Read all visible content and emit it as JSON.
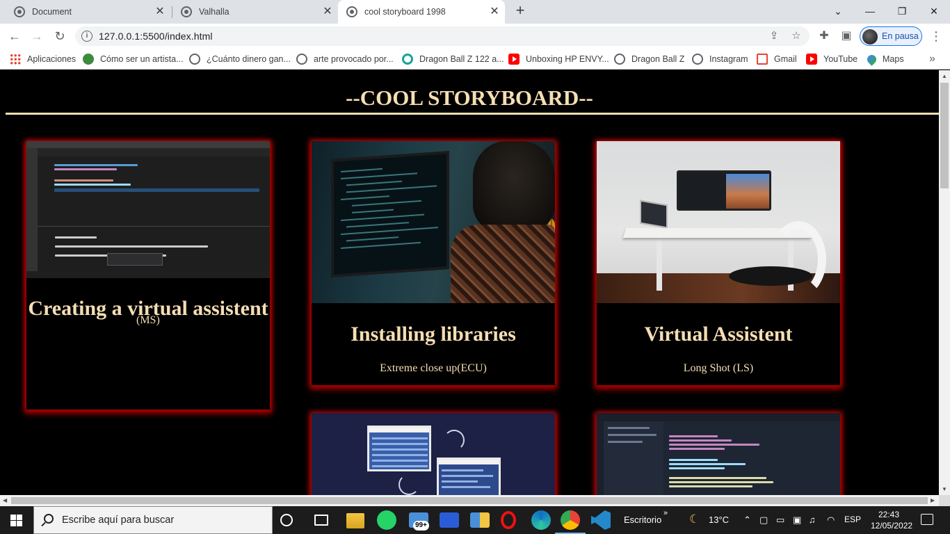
{
  "browser": {
    "tabs": [
      {
        "title": "Document",
        "active": false
      },
      {
        "title": "Valhalla",
        "active": false
      },
      {
        "title": "cool storyboard 1998",
        "active": true
      }
    ],
    "new_tab": "+",
    "window_controls": {
      "minimize": "—",
      "restore": "❐",
      "close": "✕",
      "tab_search": "⌄"
    },
    "address": {
      "url": "127.0.0.1:5500/index.html"
    },
    "profile_label": "En pausa",
    "bookmarks": [
      {
        "label": "Aplicaciones",
        "icon": "apps-icon"
      },
      {
        "label": "Cómo ser un artista...",
        "icon": "wix-icon"
      },
      {
        "label": "¿Cuánto dinero gan...",
        "icon": "globe-icon"
      },
      {
        "label": "arte provocado por...",
        "icon": "globe-icon"
      },
      {
        "label": "Dragon Ball Z 122 a...",
        "icon": "dbz-icon"
      },
      {
        "label": "Unboxing HP ENVY...",
        "icon": "youtube-icon"
      },
      {
        "label": "Dragon Ball Z",
        "icon": "globe-icon"
      },
      {
        "label": "Instagram",
        "icon": "globe-icon"
      },
      {
        "label": "Gmail",
        "icon": "gmail-icon"
      },
      {
        "label": "YouTube",
        "icon": "youtube-icon"
      },
      {
        "label": "Maps",
        "icon": "maps-icon"
      }
    ],
    "bookmarks_more": "»"
  },
  "page": {
    "title": "--COOL STORYBOARD--",
    "accent_color": "#f5deb3",
    "glow_color": "#c80000",
    "cards": [
      {
        "title": "Creating a virtual assistent",
        "shot": "(MS)"
      },
      {
        "title": "Installing libraries",
        "shot": "Extreme close up(ECU)"
      },
      {
        "title": "Virtual Assistent",
        "shot": "Long Shot (LS)"
      },
      {
        "title": "",
        "shot": ""
      },
      {
        "title": "",
        "shot": ""
      }
    ]
  },
  "taskbar": {
    "search_placeholder": "Escribe aquí para buscar",
    "badge_count": "99+",
    "desktop_label": "Escritorio",
    "weather": "13°C",
    "language": "ESP",
    "time": "22:43",
    "date": "12/05/2022"
  }
}
